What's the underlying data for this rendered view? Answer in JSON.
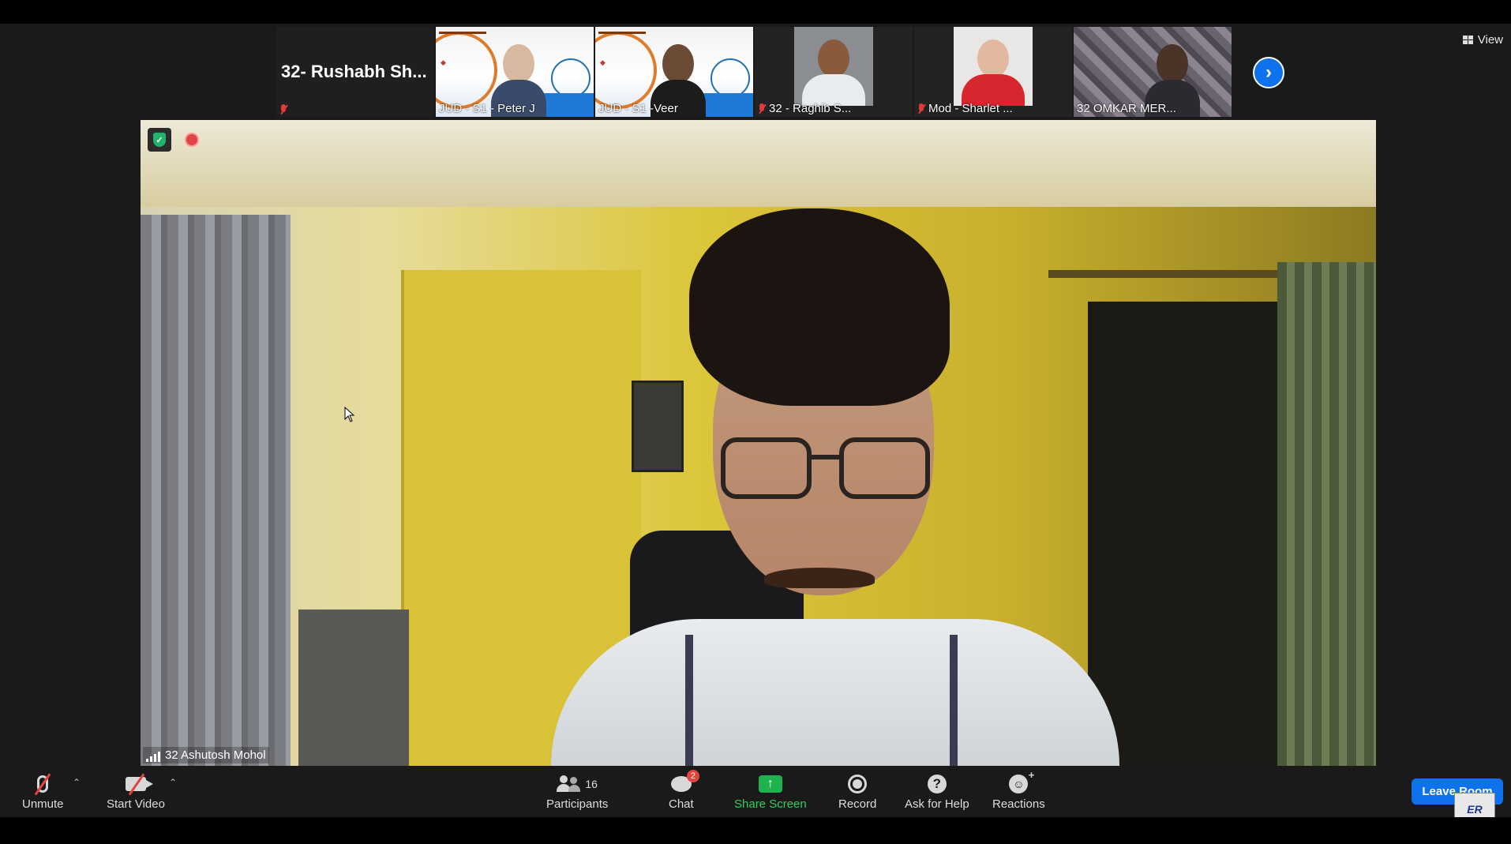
{
  "view_button": {
    "label": "View"
  },
  "thumbnails": [
    {
      "label": "32- Rushabh Sh...",
      "muted": true,
      "type": "name-only"
    },
    {
      "label": "JUD - S1 - Peter J",
      "muted": false,
      "type": "slide"
    },
    {
      "label": "JUD - S1 -Veer",
      "muted": false,
      "type": "slide"
    },
    {
      "label": "32  - Raghib S...",
      "muted": true,
      "type": "video"
    },
    {
      "label": "Mod - Sharlet ...",
      "muted": true,
      "type": "video"
    },
    {
      "label": "32 OMKAR MER...",
      "muted": false,
      "type": "video"
    }
  ],
  "main_video": {
    "participant_name": "32 Ashutosh Mohol"
  },
  "toolbar": {
    "unmute": "Unmute",
    "start_video": "Start Video",
    "participants": "Participants",
    "participants_count": "16",
    "chat": "Chat",
    "chat_badge": "2",
    "share_screen": "Share Screen",
    "record": "Record",
    "ask_for_help": "Ask for Help",
    "reactions": "Reactions",
    "leave_room": "Leave Room"
  },
  "colors": {
    "accent_blue": "#0e72ed",
    "share_green": "#1fb350",
    "muted_red": "#e03b3b",
    "toolbar_bg": "#1a1a1a"
  }
}
